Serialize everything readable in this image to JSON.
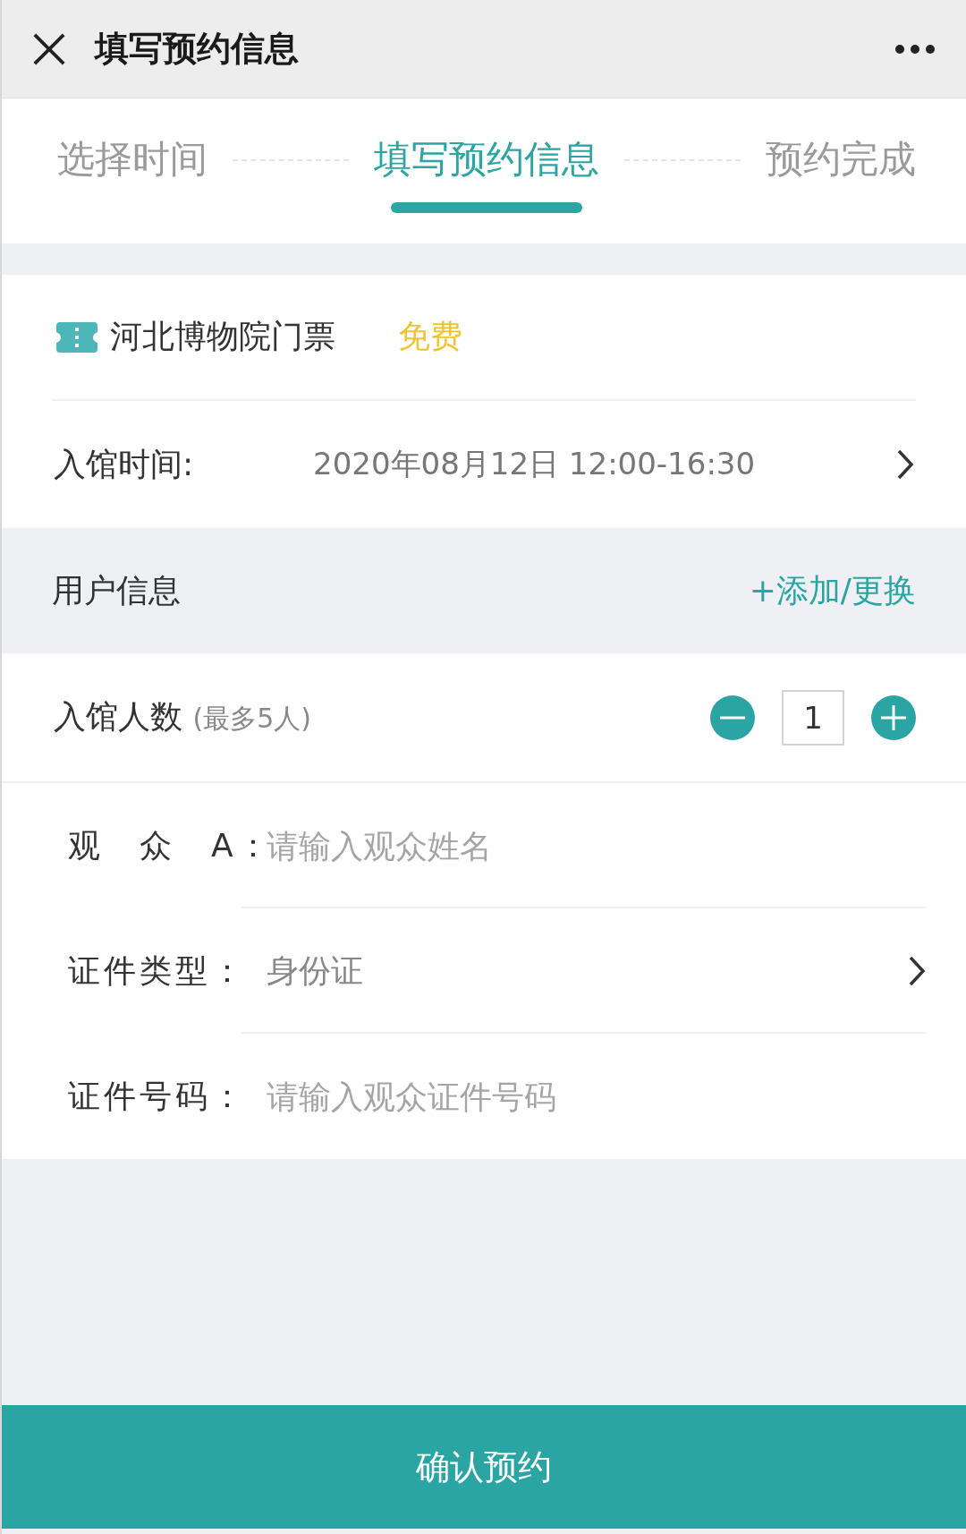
{
  "header": {
    "title": "填写预约信息"
  },
  "steps": [
    {
      "label": "选择时间",
      "selected": false
    },
    {
      "label": "填写预约信息",
      "selected": true
    },
    {
      "label": "预约完成",
      "selected": false
    }
  ],
  "ticket": {
    "name": "河北博物院门票",
    "price": "免费"
  },
  "visit_time": {
    "label": "入馆时间:",
    "value": "2020年08月12日 12:00-16:30"
  },
  "user_info": {
    "title": "用户信息",
    "action": "+添加/更换"
  },
  "visitor_count": {
    "label": "入馆人数",
    "note": "(最多5人)",
    "value": "1"
  },
  "fields": [
    {
      "kind": "input",
      "label": "观　众　A：",
      "placeholder": "请输入观众姓名"
    },
    {
      "kind": "select",
      "label": "证件类型：",
      "value": "身份证"
    },
    {
      "kind": "input",
      "label": "证件号码：",
      "placeholder": "请输入观众证件号码"
    }
  ],
  "submit": {
    "label": "确认预约"
  }
}
